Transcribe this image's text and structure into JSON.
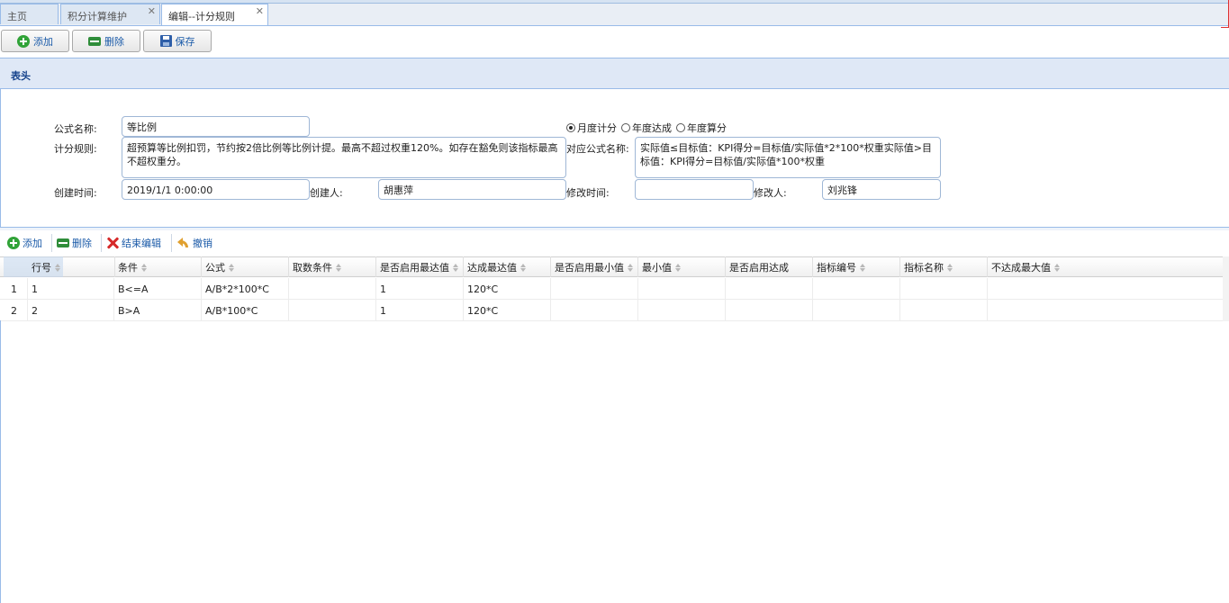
{
  "tabs": [
    {
      "label": "主页",
      "closable": false,
      "active": false
    },
    {
      "label": "积分计算维护",
      "closable": true,
      "active": false
    },
    {
      "label": "编辑--计分规则",
      "closable": true,
      "active": true
    }
  ],
  "toolbar": {
    "add": "添加",
    "delete": "删除",
    "save": "保存"
  },
  "panel": {
    "title": "表头"
  },
  "form": {
    "formula_name_label": "公式名称:",
    "formula_name": "等比例",
    "rule_label": "计分规则:",
    "rule": "超预算等比例扣罚，节约按2倍比例等比例计提。最高不超过权重120%。如存在豁免则该指标最高不超权重分。",
    "radio_monthly": "月度计分",
    "radio_annual_reach": "年度达成",
    "radio_annual_calc": "年度算分",
    "radio_selected": "monthly",
    "corr_formula_label": "对应公式名称:",
    "corr_formula": "实际值≤目标值：KPI得分=目标值/实际值*2*100*权重实际值>目标值：KPI得分=目标值/实际值*100*权重",
    "create_time_label": "创建时间:",
    "create_time": "2019/1/1 0:00:00",
    "creator_label": "创建人:",
    "creator": "胡惠萍",
    "modify_time_label": "修改时间:",
    "modify_time": "",
    "modifier_label": "修改人:",
    "modifier": "刘兆锋"
  },
  "grid_toolbar": {
    "add": "添加",
    "delete": "删除",
    "end_edit": "结束编辑",
    "undo": "撤销"
  },
  "grid": {
    "columns": [
      "行号",
      "条件",
      "公式",
      "取数条件",
      "是否启用最达值",
      "达成最达值",
      "是否启用最小值",
      "最小值",
      "是否启用达成",
      "指标编号",
      "指标名称",
      "不达成最大值"
    ],
    "rows": [
      {
        "rownum": "1",
        "cells": [
          "1",
          "B<=A",
          "A/B*2*100*C",
          "",
          "1",
          "120*C",
          "",
          "",
          "",
          "",
          "",
          ""
        ]
      },
      {
        "rownum": "2",
        "cells": [
          "2",
          "B>A",
          "A/B*100*C",
          "",
          "1",
          "120*C",
          "",
          "",
          "",
          "",
          "",
          ""
        ]
      }
    ]
  },
  "colors": {
    "accent": "#15428b",
    "border": "#99bbe8",
    "header_bg": "#dfe8f6"
  }
}
